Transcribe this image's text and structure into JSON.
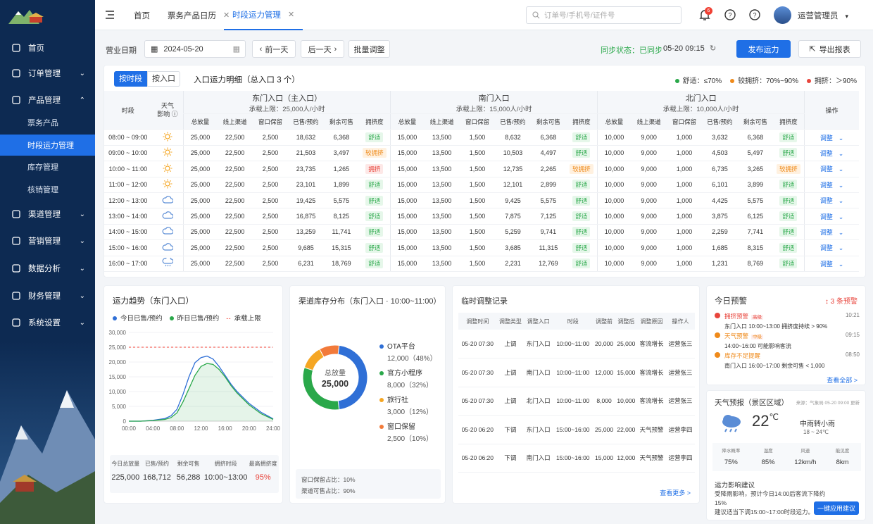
{
  "sidebar": {
    "items": [
      {
        "label": "首页",
        "icon": "home-icon"
      },
      {
        "label": "订单管理",
        "icon": "order-icon"
      },
      {
        "label": "产品管理",
        "icon": "product-icon"
      },
      {
        "label": "渠道管理",
        "icon": "channel-icon"
      },
      {
        "label": "营销管理",
        "icon": "marketing-icon"
      },
      {
        "label": "数据分析",
        "icon": "chart-icon"
      },
      {
        "label": "财务管理",
        "icon": "finance-icon"
      },
      {
        "label": "系统设置",
        "icon": "gear-icon"
      }
    ],
    "sub_items": [
      "票务产品",
      "时段运力管理",
      "库存管理",
      "核销管理"
    ]
  },
  "topbar": {
    "tabs": [
      {
        "label": "首页"
      },
      {
        "label": "票务产品日历"
      },
      {
        "label": "时段运力管理"
      }
    ],
    "search_placeholder": "订单号/手机号/证件号",
    "badge": "6",
    "user": "运营管理员"
  },
  "toolbar": {
    "date_label": "营业日期",
    "date": "2024-05-20",
    "prev": "前一天",
    "next": "后一天",
    "batch": "批量调整",
    "sync": "同步状态：已同步",
    "sync_time": "05-20 09:15",
    "publish": "发布运力",
    "export": "导出报表"
  },
  "main": {
    "seg": [
      "按时段",
      "按入口"
    ],
    "title": "入口运力明细（总入口 3 个）",
    "legend": [
      {
        "label": "舒适：≤70%",
        "color": "#2aa84a"
      },
      {
        "label": "较拥挤：70%~90%",
        "color": "#ef8a1a"
      },
      {
        "label": "拥挤：＞90%",
        "color": "#e8453c"
      }
    ],
    "col_time": "时段",
    "col_weather": "天气影响",
    "col_op": "操作",
    "gates": [
      {
        "name": "东门入口（主入口）",
        "cap": "承载上限：25,000人/小时"
      },
      {
        "name": "南门入口",
        "cap": "承载上限：15,000人/小时"
      },
      {
        "name": "北门入口",
        "cap": "承载上限：10,000人/小时"
      }
    ],
    "subcols": [
      "总放量",
      "线上渠道",
      "窗口保留",
      "已售/预约",
      "剩余可售",
      "拥挤度"
    ],
    "op_label": "调整",
    "rows": [
      {
        "time": "08:00 ~ 09:00",
        "w": "sun",
        "g": [
          [
            "25,000",
            "22,500",
            "2,500",
            "18,632",
            "6,368",
            "舒适",
            "ok"
          ],
          [
            "15,000",
            "13,500",
            "1,500",
            "8,632",
            "6,368",
            "舒适",
            "ok"
          ],
          [
            "10,000",
            "9,000",
            "1,000",
            "3,632",
            "6,368",
            "舒适",
            "ok"
          ]
        ]
      },
      {
        "time": "09:00 ~ 10:00",
        "w": "sun",
        "g": [
          [
            "25,000",
            "22,500",
            "2,500",
            "21,503",
            "3,497",
            "较拥挤",
            "mid"
          ],
          [
            "15,000",
            "13,500",
            "1,500",
            "10,503",
            "4,497",
            "舒适",
            "ok"
          ],
          [
            "10,000",
            "9,000",
            "1,000",
            "4,503",
            "5,497",
            "舒适",
            "ok"
          ]
        ]
      },
      {
        "time": "10:00 ~ 11:00",
        "w": "sun",
        "g": [
          [
            "25,000",
            "22,500",
            "2,500",
            "23,735",
            "1,265",
            "拥挤",
            "hot"
          ],
          [
            "15,000",
            "13,500",
            "1,500",
            "12,735",
            "2,265",
            "较拥挤",
            "mid"
          ],
          [
            "10,000",
            "9,000",
            "1,000",
            "6,735",
            "3,265",
            "较拥挤",
            "mid"
          ]
        ]
      },
      {
        "time": "11:00 ~ 12:00",
        "w": "sun",
        "g": [
          [
            "25,000",
            "22,500",
            "2,500",
            "23,101",
            "1,899",
            "舒适",
            "ok"
          ],
          [
            "15,000",
            "13,500",
            "1,500",
            "12,101",
            "2,899",
            "舒适",
            "ok"
          ],
          [
            "10,000",
            "9,000",
            "1,000",
            "6,101",
            "3,899",
            "舒适",
            "ok"
          ]
        ]
      },
      {
        "time": "12:00 ~ 13:00",
        "w": "cloud",
        "g": [
          [
            "25,000",
            "22,500",
            "2,500",
            "19,425",
            "5,575",
            "舒适",
            "ok"
          ],
          [
            "15,000",
            "13,500",
            "1,500",
            "9,425",
            "5,575",
            "舒适",
            "ok"
          ],
          [
            "10,000",
            "9,000",
            "1,000",
            "4,425",
            "5,575",
            "舒适",
            "ok"
          ]
        ]
      },
      {
        "time": "13:00 ~ 14:00",
        "w": "cloud",
        "g": [
          [
            "25,000",
            "22,500",
            "2,500",
            "16,875",
            "8,125",
            "舒适",
            "ok"
          ],
          [
            "15,000",
            "13,500",
            "1,500",
            "7,875",
            "7,125",
            "舒适",
            "ok"
          ],
          [
            "10,000",
            "9,000",
            "1,000",
            "3,875",
            "6,125",
            "舒适",
            "ok"
          ]
        ]
      },
      {
        "time": "14:00 ~ 15:00",
        "w": "cloud",
        "g": [
          [
            "25,000",
            "22,500",
            "2,500",
            "13,259",
            "11,741",
            "舒适",
            "ok"
          ],
          [
            "15,000",
            "13,500",
            "1,500",
            "5,259",
            "9,741",
            "舒适",
            "ok"
          ],
          [
            "10,000",
            "9,000",
            "1,000",
            "2,259",
            "7,741",
            "舒适",
            "ok"
          ]
        ]
      },
      {
        "time": "15:00 ~ 16:00",
        "w": "cloud",
        "g": [
          [
            "25,000",
            "22,500",
            "2,500",
            "9,685",
            "15,315",
            "舒适",
            "ok"
          ],
          [
            "15,000",
            "13,500",
            "1,500",
            "3,685",
            "11,315",
            "舒适",
            "ok"
          ],
          [
            "10,000",
            "9,000",
            "1,000",
            "1,685",
            "8,315",
            "舒适",
            "ok"
          ]
        ]
      },
      {
        "time": "16:00 ~ 17:00",
        "w": "rain",
        "g": [
          [
            "25,000",
            "22,500",
            "2,500",
            "6,231",
            "18,769",
            "舒适",
            "ok"
          ],
          [
            "15,000",
            "13,500",
            "1,500",
            "2,231",
            "12,769",
            "舒适",
            "ok"
          ],
          [
            "10,000",
            "9,000",
            "1,000",
            "1,231",
            "8,769",
            "舒适",
            "ok"
          ]
        ]
      }
    ]
  },
  "trend": {
    "title": "运力趋势（东门入口）",
    "legend": [
      "今日已售/预约",
      "昨日已售/预约",
      "承载上限"
    ],
    "stats": [
      {
        "label": "今日总放量",
        "value": "225,000"
      },
      {
        "label": "已售/预约",
        "value": "168,712"
      },
      {
        "label": "剩余可售",
        "value": "56,288"
      },
      {
        "label": "拥挤时段",
        "value": "10:00~13:00"
      },
      {
        "label": "最高拥挤度",
        "value": "95%"
      }
    ]
  },
  "chart_data": {
    "type": "line",
    "x": [
      "00:00",
      "04:00",
      "08:00",
      "12:00",
      "16:00",
      "20:00",
      "24:00"
    ],
    "yticks": [
      "0",
      "5,000",
      "10,000",
      "15,000",
      "20,000",
      "25,000",
      "30,000"
    ],
    "ylim": [
      0,
      30000
    ],
    "series": [
      {
        "name": "今日已售/预约",
        "color": "#2f6fd6",
        "x": [
          0,
          2,
          4,
          6,
          7,
          8,
          9,
          10,
          11,
          12,
          13,
          14,
          15,
          16,
          17,
          18,
          20,
          22,
          24
        ],
        "values": [
          0,
          0,
          300,
          900,
          1800,
          4000,
          9000,
          15000,
          19800,
          21500,
          22000,
          21000,
          18500,
          15500,
          12500,
          10000,
          6000,
          3000,
          800
        ]
      },
      {
        "name": "昨日已售/预约",
        "color": "#2aa84a",
        "x": [
          0,
          2,
          4,
          6,
          7,
          8,
          9,
          10,
          11,
          12,
          13,
          14,
          15,
          16,
          17,
          18,
          20,
          22,
          24
        ],
        "values": [
          0,
          0,
          200,
          600,
          1200,
          2800,
          6500,
          11000,
          15500,
          18500,
          19500,
          19200,
          17500,
          15000,
          12000,
          9500,
          5500,
          2500,
          600
        ]
      },
      {
        "name": "承载上限",
        "color": "#f04134",
        "dashed": true,
        "x": [
          0,
          24
        ],
        "values": [
          25000,
          25000
        ]
      }
    ]
  },
  "inventory": {
    "title": "渠道库存分布（东门入口 · 10:00~11:00）",
    "center_label": "总放量",
    "center_value": "25,000",
    "slices": [
      {
        "name": "OTA平台",
        "value": "12,000",
        "pct": "（48%）",
        "share": 48,
        "color": "#2f6fd6"
      },
      {
        "name": "官方小程序",
        "value": "8,000",
        "pct": "（32%）",
        "share": 32,
        "color": "#2aa84a"
      },
      {
        "name": "旅行社",
        "value": "3,000",
        "pct": "（12%）",
        "share": 12,
        "color": "#f5a623"
      },
      {
        "name": "窗口保留",
        "value": "2,500",
        "pct": "（10%）",
        "share": 10,
        "color": "#f27a3a"
      }
    ],
    "notes": [
      "窗口保留占比：10%",
      "渠道可售占比：90%"
    ]
  },
  "adjust": {
    "title": "临时调整记录",
    "headers": [
      "调整时间",
      "调整类型",
      "调整入口",
      "时段",
      "调整前",
      "调整后",
      "调整原因",
      "操作人"
    ],
    "rows": [
      [
        "05-20 07:30",
        "上调",
        "东门入口",
        "10:00~11:00",
        "20,000",
        "25,000",
        "客流增长",
        "运营张三"
      ],
      [
        "05-20 07:30",
        "上调",
        "南门入口",
        "10:00~11:00",
        "12,000",
        "15,000",
        "客流增长",
        "运营张三"
      ],
      [
        "05-20 07:30",
        "上调",
        "北门入口",
        "10:00~11:00",
        "8,000",
        "10,000",
        "客流增长",
        "运营张三"
      ],
      [
        "05-20 06:20",
        "下调",
        "东门入口",
        "15:00~16:00",
        "25,000",
        "22,000",
        "天气预警",
        "运营李四"
      ],
      [
        "05-20 06:20",
        "下调",
        "南门入口",
        "15:00~16:00",
        "15,000",
        "12,000",
        "天气预警",
        "运营李四"
      ]
    ],
    "more": "查看更多 >"
  },
  "warnings": {
    "title": "今日预警",
    "count": "3 条预警",
    "items": [
      {
        "name": "拥挤预警",
        "tag": "高级",
        "desc": "东门入口 10:00~13:00 拥挤度持续 > 90%",
        "time": "10:21",
        "color": "#e8453c"
      },
      {
        "name": "天气预警",
        "tag": "中级",
        "desc": "14:00~16:00 可能影响客流",
        "time": "09:15",
        "color": "#ef8a1a"
      },
      {
        "name": "库存不足提醒",
        "tag": "",
        "desc": "南门入口 16:00~17:00 剩余可售 < 1,000",
        "time": "08:50",
        "color": "#ef8a1a"
      }
    ],
    "view_all": "查看全部 >"
  },
  "weather": {
    "title": "天气预报（景区区域）",
    "source": "来源：气象局 05-20 09:00 更新",
    "temp": "22",
    "unit": "℃",
    "desc": "中雨转小雨",
    "range": "18 ~ 24℃",
    "metrics": [
      {
        "label": "降水概率",
        "value": "75%"
      },
      {
        "label": "湿度",
        "value": "85%"
      },
      {
        "label": "风速",
        "value": "12km/h"
      },
      {
        "label": "能见度",
        "value": "8km"
      }
    ],
    "advice_title": "运力影响建议",
    "advice": "受降雨影响，预计今日14:00后客流下降约15%",
    "advice2": "建议适当下调15:00~17:00时段运力。",
    "apply": "一键应用建议"
  }
}
